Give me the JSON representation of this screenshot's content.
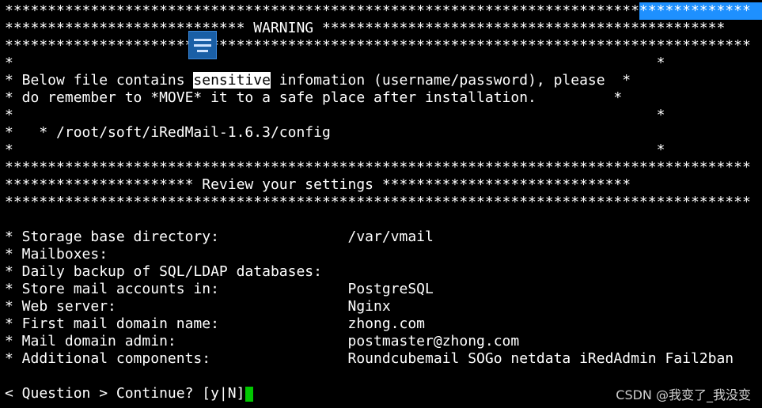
{
  "terminal": {
    "lines_top": [
      "***************************************************************************************",
      "**************************** WARNING ***********************************************",
      "***************************************************************************************",
      "*                                                                           *",
      "*                                                                           *",
      "*                                                                           *",
      "*   * /root/soft/iRedMail-1.6.3/config",
      "*                                                                           *",
      "***************************************************************************************",
      "********************** Review your settings *****************************",
      "***************************************************************************************"
    ],
    "sensitive_line": {
      "before": "* Below file contains ",
      "highlight": "sensitive",
      "after": " infomation (username/password), please  *"
    },
    "line_move": "* do remember to *MOVE* it to a safe place after installation.         *",
    "settings": [
      {
        "label": "* Storage base directory:               ",
        "value": "/var/vmail"
      },
      {
        "label": "* Mailboxes:",
        "value": ""
      },
      {
        "label": "* Daily backup of SQL/LDAP databases:",
        "value": ""
      },
      {
        "label": "* Store mail accounts in:               ",
        "value": "PostgreSQL"
      },
      {
        "label": "* Web server:                           ",
        "value": "Nginx"
      },
      {
        "label": "* First mail domain name:               ",
        "value": "zhong.com"
      },
      {
        "label": "* Mail domain admin:                    ",
        "value": "postmaster@zhong.com"
      },
      {
        "label": "* Additional components:                ",
        "value": "Roundcubemail SOGo netdata iRedAdmin Fail2ban"
      }
    ],
    "prompt": "< Question > Continue? [y|N]"
  },
  "watermark": "CSDN @我变了_我没变",
  "colors": {
    "background": "#000000",
    "text": "#ffffff",
    "cursor": "#00c800",
    "top_right_block": "#1e90ff",
    "overlay_icon": "#1a5fa6"
  },
  "icons": {
    "overlay": "menu-list-icon"
  }
}
